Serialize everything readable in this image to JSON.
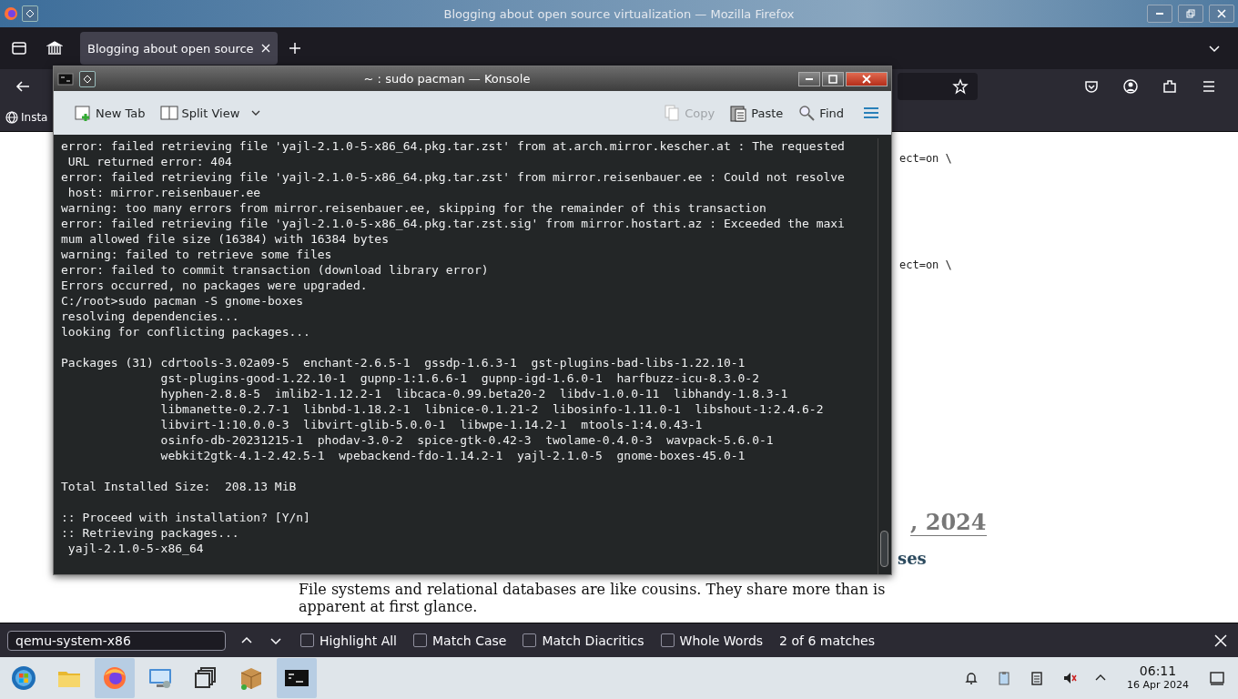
{
  "browser": {
    "window_title": "Blogging about open source virtualization — Mozilla Firefox",
    "tabs": [
      {
        "title": "Blogging about open source",
        "selected": true
      }
    ],
    "bookmark": "Insta"
  },
  "page": {
    "code_lines": [
      "ect=on \\",
      "ect=on \\"
    ],
    "heading": ", 2024",
    "subheading": "ses",
    "paragraph": "File systems and relational databases are like cousins. They share more than is apparent at first glance."
  },
  "konsole": {
    "title": "~ : sudo pacman — Konsole",
    "toolbar_left": [
      {
        "kind": "new-tab",
        "label": "New Tab",
        "disabled": false
      },
      {
        "kind": "split-view",
        "label": "Split View",
        "disabled": false
      }
    ],
    "toolbar_right": [
      {
        "kind": "copy",
        "label": "Copy",
        "disabled": true
      },
      {
        "kind": "paste",
        "label": "Paste",
        "disabled": false
      },
      {
        "kind": "find",
        "label": "Find",
        "disabled": false
      }
    ],
    "lines": [
      {
        "kind": "text",
        "text": "error: failed retrieving file 'yajl-2.1.0-5-x86_64.pkg.tar.zst' from at.arch.mirror.kescher.at : The requested"
      },
      {
        "kind": "text",
        "text": " URL returned error: 404"
      },
      {
        "kind": "text",
        "text": "error: failed retrieving file 'yajl-2.1.0-5-x86_64.pkg.tar.zst' from mirror.reisenbauer.ee : Could not resolve"
      },
      {
        "kind": "text",
        "text": " host: mirror.reisenbauer.ee"
      },
      {
        "kind": "text",
        "text": "warning: too many errors from mirror.reisenbauer.ee, skipping for the remainder of this transaction"
      },
      {
        "kind": "text",
        "text": "error: failed retrieving file 'yajl-2.1.0-5-x86_64.pkg.tar.zst.sig' from mirror.hostart.az : Exceeded the maxi"
      },
      {
        "kind": "text",
        "text": "mum allowed file size (16384) with 16384 bytes"
      },
      {
        "kind": "text",
        "text": "warning: failed to retrieve some files"
      },
      {
        "kind": "text",
        "text": "error: failed to commit transaction (download library error)"
      },
      {
        "kind": "text",
        "text": "Errors occurred, no packages were upgraded."
      },
      {
        "kind": "text",
        "text": "C:/root>sudo pacman -S gnome-boxes"
      },
      {
        "kind": "text",
        "text": "resolving dependencies..."
      },
      {
        "kind": "text",
        "text": "looking for conflicting packages..."
      },
      {
        "kind": "blank"
      },
      {
        "kind": "text",
        "text": "Packages (31) cdrtools-3.02a09-5  enchant-2.6.5-1  gssdp-1.6.3-1  gst-plugins-bad-libs-1.22.10-1"
      },
      {
        "kind": "text",
        "text": "              gst-plugins-good-1.22.10-1  gupnp-1:1.6.6-1  gupnp-igd-1.6.0-1  harfbuzz-icu-8.3.0-2"
      },
      {
        "kind": "text",
        "text": "              hyphen-2.8.8-5  imlib2-1.12.2-1  libcaca-0.99.beta20-2  libdv-1.0.0-11  libhandy-1.8.3-1"
      },
      {
        "kind": "text",
        "text": "              libmanette-0.2.7-1  libnbd-1.18.2-1  libnice-0.1.21-2  libosinfo-1.11.0-1  libshout-1:2.4.6-2"
      },
      {
        "kind": "text",
        "text": "              libvirt-1:10.0.0-3  libvirt-glib-5.0.0-1  libwpe-1.14.2-1  mtools-1:4.0.43-1"
      },
      {
        "kind": "text",
        "text": "              osinfo-db-20231215-1  phodav-3.0-2  spice-gtk-0.42-3  twolame-0.4.0-3  wavpack-5.6.0-1"
      },
      {
        "kind": "text",
        "text": "              webkit2gtk-4.1-2.42.5-1  wpebackend-fdo-1.14.2-1  yajl-2.1.0-5  gnome-boxes-45.0-1"
      },
      {
        "kind": "blank"
      },
      {
        "kind": "text",
        "text": "Total Installed Size:  208.13 MiB"
      },
      {
        "kind": "blank"
      },
      {
        "kind": "text",
        "text": ":: Proceed with installation? [Y/n]"
      },
      {
        "kind": "text",
        "text": ":: Retrieving packages..."
      },
      {
        "kind": "text",
        "text": " yajl-2.1.0-5-x86_64"
      }
    ]
  },
  "find_bar": {
    "value": "qemu-system-x86",
    "options": [
      {
        "label": "Highlight All",
        "checked": false
      },
      {
        "label": "Match Case",
        "checked": false
      },
      {
        "label": "Match Diacritics",
        "checked": false
      },
      {
        "label": "Whole Words",
        "checked": false
      }
    ],
    "status": "2 of 6 matches"
  },
  "taskbar": {
    "tasks": [
      {
        "kind": "start",
        "active": false
      },
      {
        "kind": "files",
        "active": false
      },
      {
        "kind": "firefox",
        "active": true
      },
      {
        "kind": "settings",
        "active": false
      },
      {
        "kind": "windows",
        "active": false
      },
      {
        "kind": "package",
        "active": false
      },
      {
        "kind": "terminal",
        "active": true
      }
    ],
    "clock": {
      "time": "06:11",
      "date": "16 Apr 2024"
    }
  }
}
